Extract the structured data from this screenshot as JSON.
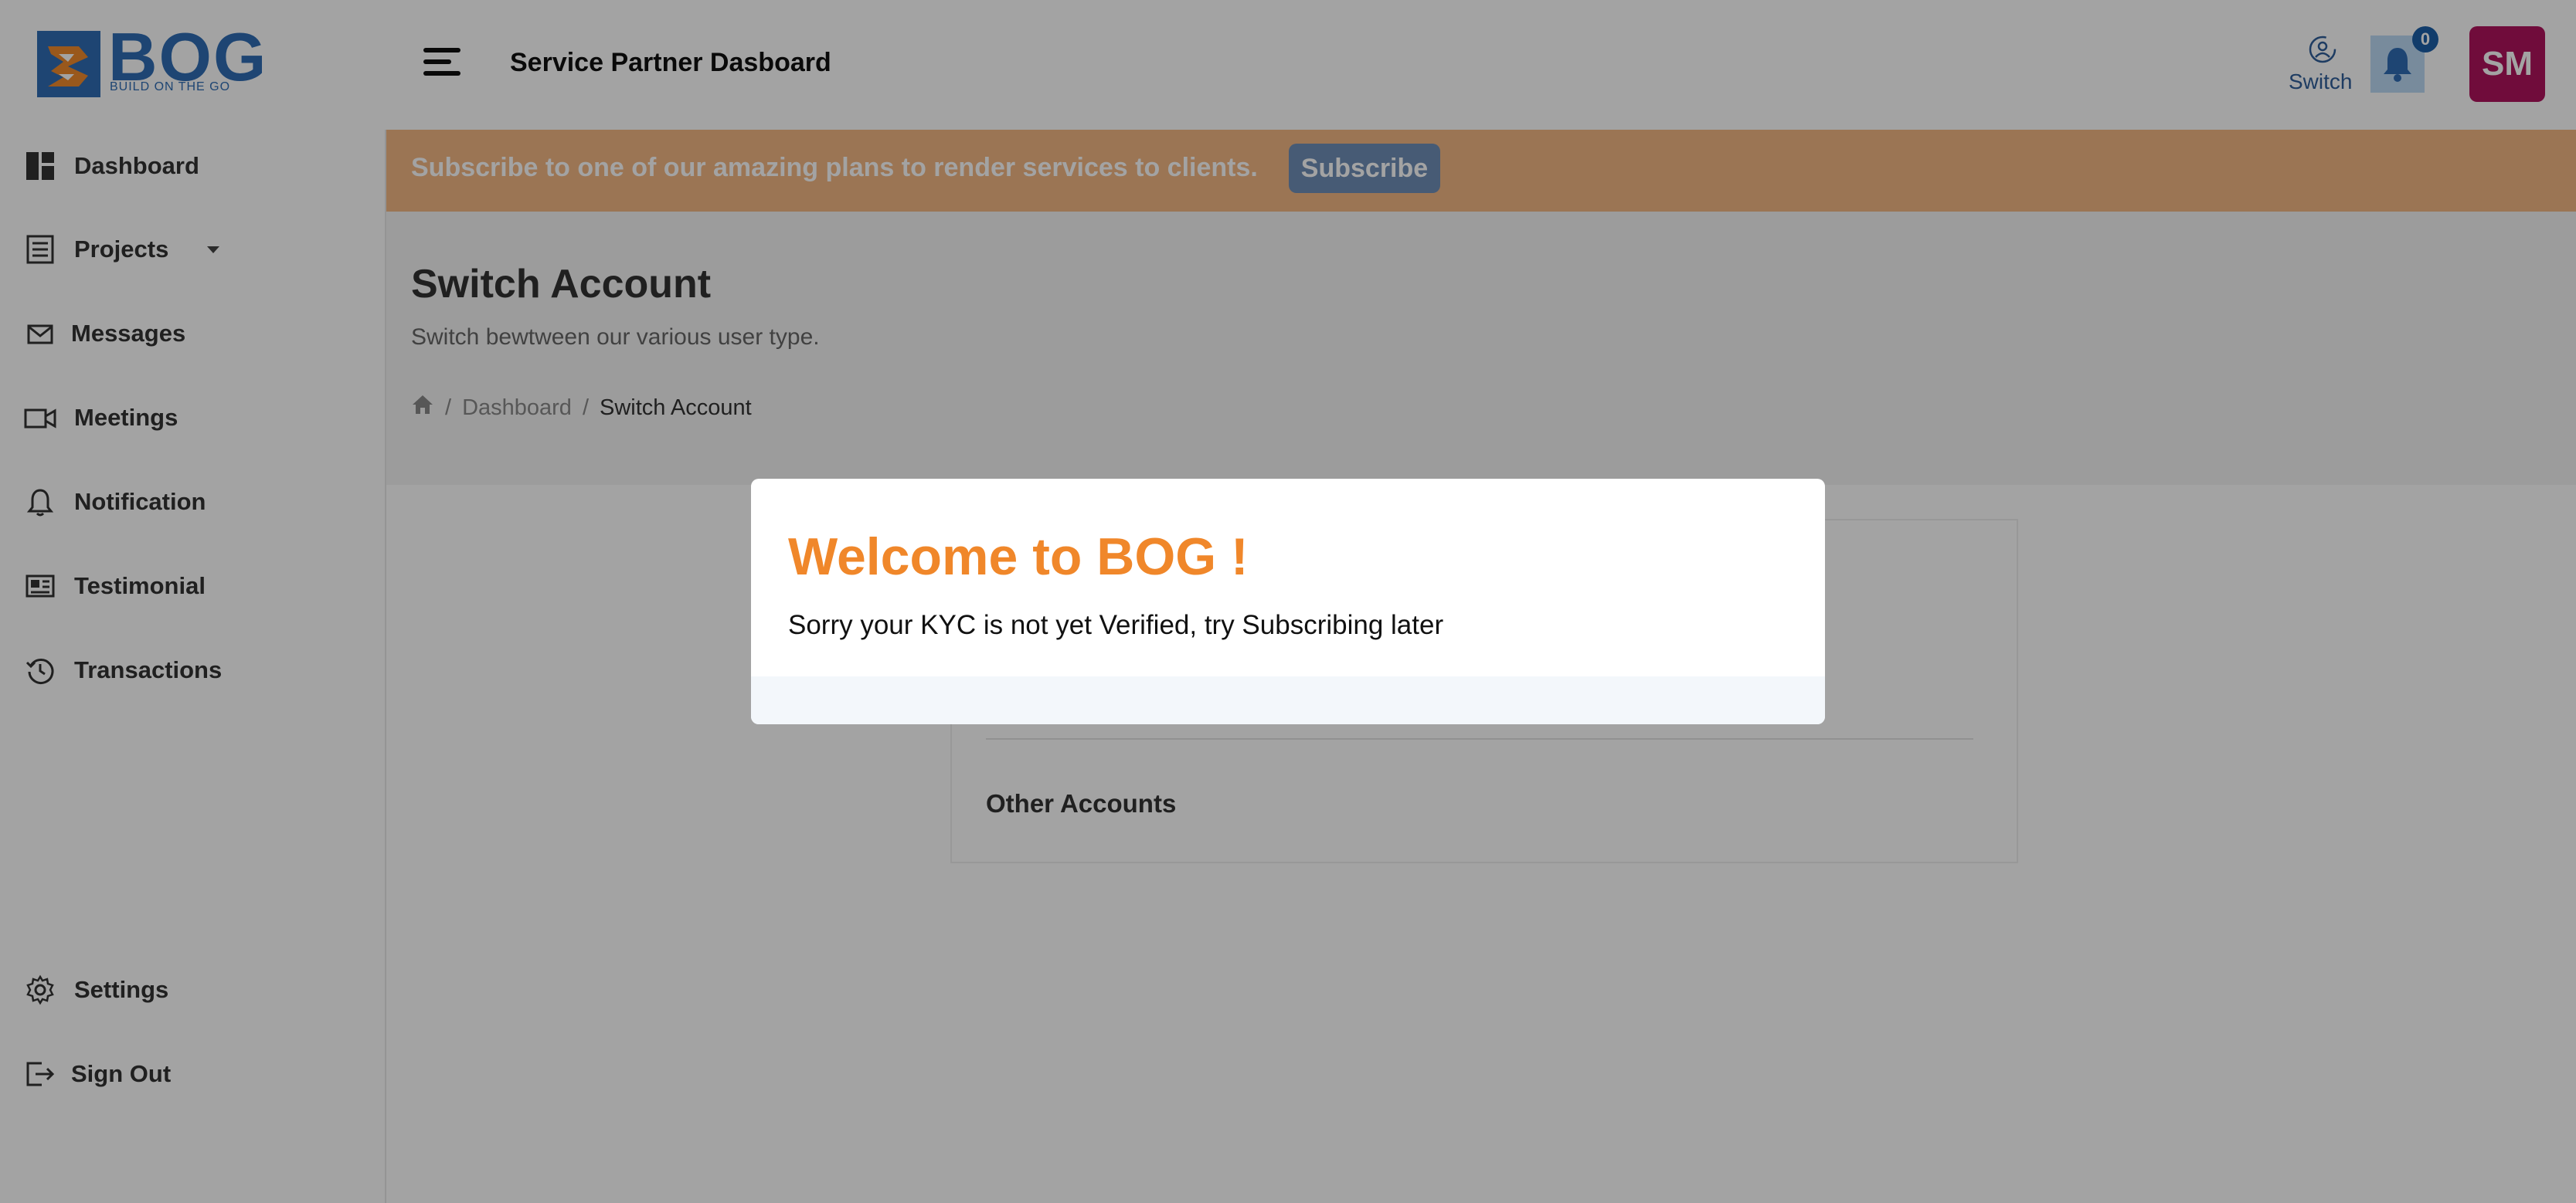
{
  "header": {
    "logo_text": "BOG",
    "logo_tagline": "BUILD ON THE GO",
    "title": "Service Partner Dasboard",
    "switch_label": "Switch",
    "notification_count": "0",
    "avatar_initials": "SM"
  },
  "sidebar": {
    "items": [
      {
        "label": "Dashboard",
        "icon": "dashboard-icon"
      },
      {
        "label": "Projects",
        "icon": "projects-icon"
      },
      {
        "label": "Messages",
        "icon": "mail-icon"
      },
      {
        "label": "Meetings",
        "icon": "video-icon"
      },
      {
        "label": "Notification",
        "icon": "bell-icon"
      },
      {
        "label": "Testimonial",
        "icon": "newspaper-icon"
      },
      {
        "label": "Transactions",
        "icon": "history-icon"
      }
    ],
    "bottom": [
      {
        "label": "Settings",
        "icon": "gear-icon"
      },
      {
        "label": "Sign Out",
        "icon": "sign-out-icon"
      }
    ]
  },
  "banner": {
    "text": "Subscribe to one of our amazing plans to render services to clients.",
    "button": "Subscribe"
  },
  "page": {
    "title": "Switch Account",
    "subtitle": "Switch bewtween our various user type.",
    "breadcrumb": [
      "Dashboard",
      "Switch Account"
    ]
  },
  "card": {
    "other_accounts": "Other Accounts"
  },
  "modal": {
    "title": "Welcome to BOG !",
    "message": "Sorry your KYC is not yet Verified, try Subscribing later"
  },
  "colors": {
    "brand_blue": "#2f6db4",
    "accent_orange": "#f0872a",
    "avatar_bg": "#b0135d",
    "banner_bg": "#f2b884"
  }
}
